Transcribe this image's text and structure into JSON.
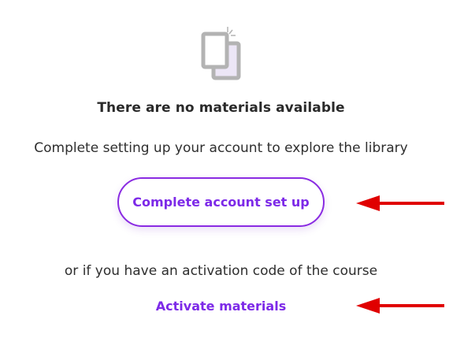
{
  "empty_state": {
    "icon": "documents-stack-icon",
    "title": "There are no materials available",
    "subtitle": "Complete setting up your account to explore the library",
    "cta_label": "Complete account set up",
    "or_text": "or if you have an activation code of the course",
    "activate_label": "Activate materials"
  },
  "colors": {
    "accent": "#7d2ae8",
    "annotation_arrow": "#e00000",
    "icon_gray": "#b3b3b3",
    "icon_lavender": "#ece6f6"
  }
}
